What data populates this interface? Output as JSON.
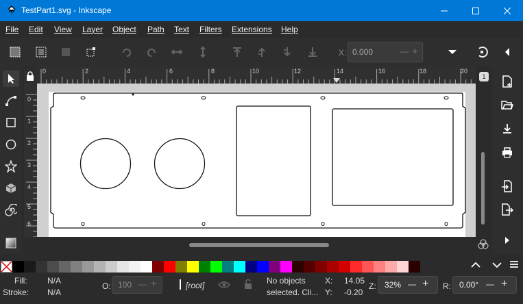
{
  "window": {
    "title": "TestPart1.svg - Inkscape"
  },
  "menu": [
    "File",
    "Edit",
    "View",
    "Layer",
    "Object",
    "Path",
    "Text",
    "Filters",
    "Extensions",
    "Help"
  ],
  "toolbar": {
    "x_label": "X:",
    "x_value": "0.000",
    "minus": "—",
    "plus": "+"
  },
  "ruler": {
    "h_ticks": [
      "0",
      "2",
      "4",
      "6",
      "8",
      "10",
      "12",
      "14",
      "16",
      "18",
      "20"
    ],
    "v_ticks": [
      "0",
      "1",
      "2",
      "3",
      "4",
      "5",
      "6"
    ]
  },
  "right_badge": "1",
  "icons": {
    "select": "pointer-icon",
    "node": "node-icon",
    "rect": "rect-icon",
    "circle": "circle-icon",
    "star": "star-icon",
    "box3d": "box3d-icon",
    "spiral": "spiral-icon",
    "gradient": "gradient-icon"
  },
  "palette_colors": [
    "#000000",
    "#1a1a1a",
    "#333333",
    "#4d4d4d",
    "#666666",
    "#808080",
    "#999999",
    "#b3b3b3",
    "#cccccc",
    "#e6e6e6",
    "#f2f2f2",
    "#ffffff",
    "#800000",
    "#ff0000",
    "#808000",
    "#ffff00",
    "#008000",
    "#00ff00",
    "#008080",
    "#00ffff",
    "#000080",
    "#0000ff",
    "#800080",
    "#ff00ff",
    "#2b0000",
    "#550000",
    "#800000",
    "#aa0000",
    "#d40000",
    "#ff2a2a",
    "#ff5555",
    "#ff8080",
    "#ffaaaa",
    "#ffd5d5",
    "#2b0000"
  ],
  "status": {
    "fill_label": "Fill:",
    "fill_value": "N/A",
    "stroke_label": "Stroke:",
    "stroke_value": "N/A",
    "opacity_label": "O:",
    "opacity_value": "100",
    "layer": "[root]",
    "message_line1": "No objects",
    "message_line2": "selected. Cli...",
    "x_label": "X:",
    "x_value": "14.05",
    "y_label": "Y:",
    "y_value": "-0.20",
    "zoom_label": "Z:",
    "zoom_value": "32%",
    "rotate_label": "R:",
    "rotate_value": "0.00°",
    "minus": "—",
    "plus": "+"
  }
}
